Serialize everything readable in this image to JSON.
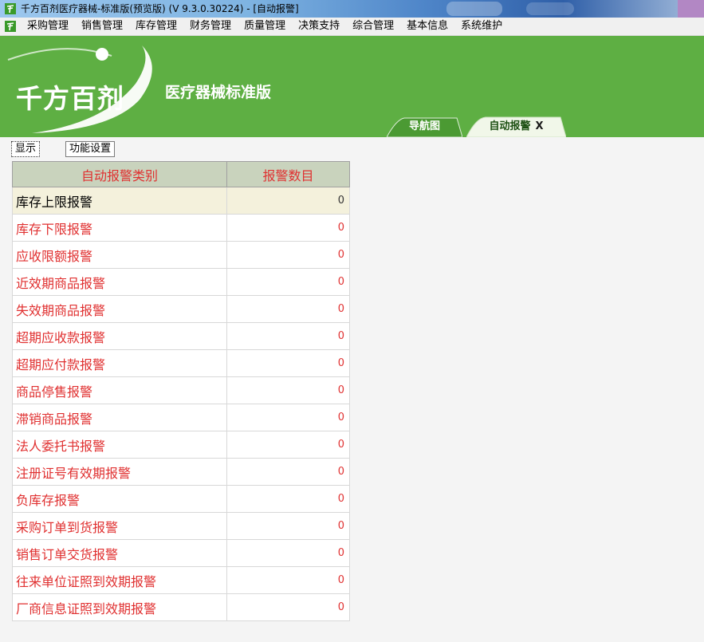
{
  "window": {
    "title": "千方百剂医疗器械-标准版(预览版) (V 9.3.0.30224)  - [自动报警]"
  },
  "menu": {
    "items": [
      "采购管理",
      "销售管理",
      "库存管理",
      "财务管理",
      "质量管理",
      "决策支持",
      "综合管理",
      "基本信息",
      "系统维护"
    ]
  },
  "banner": {
    "logo_text": "千方百剂",
    "subtitle": "医疗器械标准版",
    "tabs": {
      "nav_label": "导航图",
      "alarm_label": "自动报警",
      "close_glyph": "X"
    }
  },
  "subbar": {
    "show_label": "显示",
    "func_label": "功能设置"
  },
  "table": {
    "headers": [
      "自动报警类别",
      "报警数目"
    ],
    "rows": [
      {
        "name": "库存上限报警",
        "count": "0"
      },
      {
        "name": "库存下限报警",
        "count": "0"
      },
      {
        "name": "应收限额报警",
        "count": "0"
      },
      {
        "name": "近效期商品报警",
        "count": "0"
      },
      {
        "name": "失效期商品报警",
        "count": "0"
      },
      {
        "name": "超期应收款报警",
        "count": "0"
      },
      {
        "name": "超期应付款报警",
        "count": "0"
      },
      {
        "name": "商品停售报警",
        "count": "0"
      },
      {
        "name": "滞销商品报警",
        "count": "0"
      },
      {
        "name": "法人委托书报警",
        "count": "0"
      },
      {
        "name": "注册证号有效期报警",
        "count": "0"
      },
      {
        "name": "负库存报警",
        "count": "0"
      },
      {
        "name": "采购订单到货报警",
        "count": "0"
      },
      {
        "name": "销售订单交货报警",
        "count": "0"
      },
      {
        "name": "往来单位证照到效期报警",
        "count": "0"
      },
      {
        "name": "厂商信息证照到效期报警",
        "count": "0"
      }
    ]
  },
  "colors": {
    "banner_green": "#5eaf43",
    "alarm_text_red": "#e03030",
    "header_bg": "#c9d3bd",
    "selected_row_bg": "#f4f1dc"
  }
}
